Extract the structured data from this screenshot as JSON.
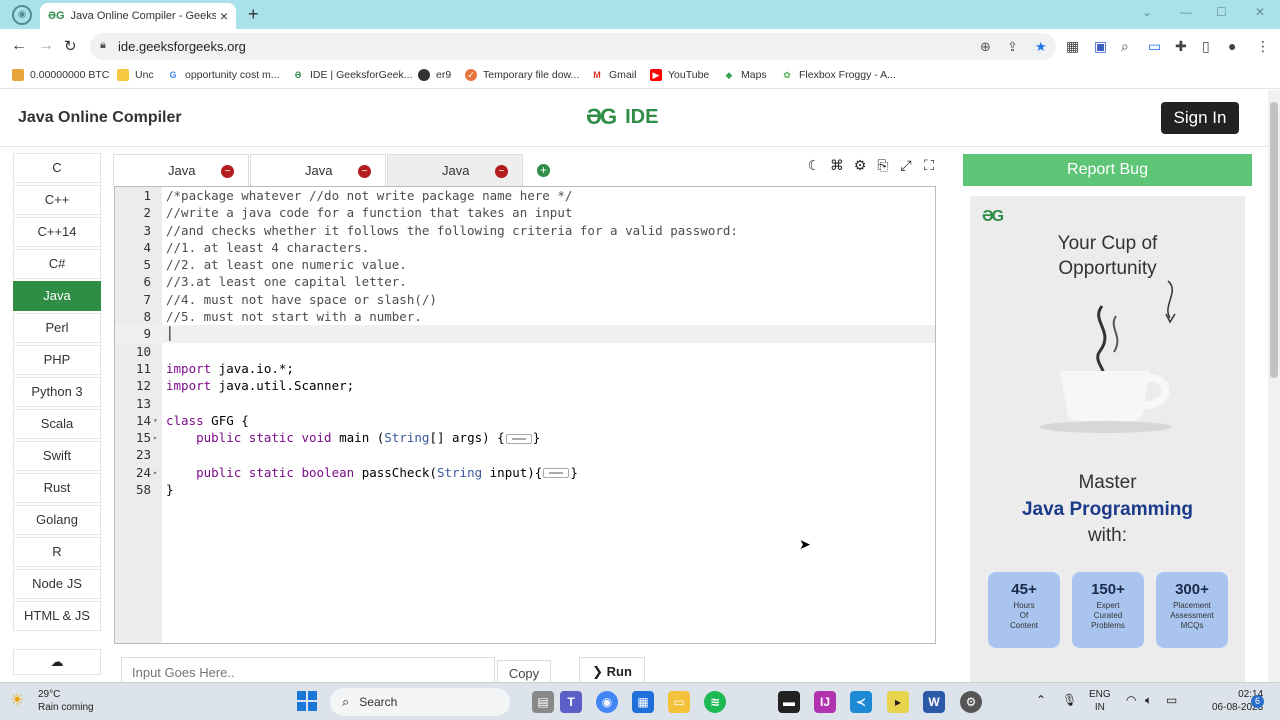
{
  "browser": {
    "tab_title": "Java Online Compiler - GeeksforGeeks",
    "url": "ide.geeksforgeeks.org",
    "bookmarks": [
      "0.00000000 BTC",
      "Unc",
      "opportunity cost m...",
      "IDE | GeeksforGeek...",
      "er9",
      "Temporary file dow...",
      "Gmail",
      "YouTube",
      "Maps",
      "Flexbox Froggy - A..."
    ]
  },
  "header": {
    "title": "Java Online Compiler",
    "brand_text": "IDE",
    "signin_label": "Sign In"
  },
  "languages": [
    "C",
    "C++",
    "C++14",
    "C#",
    "Java",
    "Perl",
    "PHP",
    "Python 3",
    "Scala",
    "Swift",
    "Rust",
    "Golang",
    "R",
    "Node JS",
    "HTML & JS"
  ],
  "active_language": "Java",
  "editor_tabs": [
    {
      "label": "Java",
      "active": false
    },
    {
      "label": "Java",
      "active": false
    },
    {
      "label": "Java",
      "active": true
    }
  ],
  "code_lines": [
    {
      "n": "1",
      "text": "/*package whatever //do not write package name here */"
    },
    {
      "n": "2",
      "text": "//write a java code for a function that takes an input"
    },
    {
      "n": "3",
      "text": "//and checks whether it follows the following criteria for a valid password:"
    },
    {
      "n": "4",
      "text": "//1. at least 4 characters."
    },
    {
      "n": "5",
      "text": "//2. at least one numeric value."
    },
    {
      "n": "6",
      "text": "//3.at least one capital letter."
    },
    {
      "n": "7",
      "text": "//4. must not have space or slash(/)"
    },
    {
      "n": "8",
      "text": "//5. must not start with a number."
    },
    {
      "n": "9",
      "text": ""
    },
    {
      "n": "10",
      "text": ""
    },
    {
      "n": "11",
      "text": "import java.io.*;"
    },
    {
      "n": "12",
      "text": "import java.util.Scanner;"
    },
    {
      "n": "13",
      "text": ""
    },
    {
      "n": "14",
      "text": "class GFG {"
    },
    {
      "n": "15",
      "text": "    public static void main (String[] args) {"
    },
    {
      "n": "23",
      "text": ""
    },
    {
      "n": "24",
      "text": "    public static boolean passCheck(String input){"
    },
    {
      "n": "58",
      "text": "}"
    }
  ],
  "input": {
    "placeholder": "Input Goes Here.."
  },
  "copy_label": "Copy",
  "run_label": "Run",
  "report_bug_label": "Report Bug",
  "ad": {
    "cup_title": "Your Cup of\nOpportunity",
    "master": "Master",
    "java": "Java Programming",
    "with": "with:",
    "stats": [
      {
        "num": "45+",
        "label": "Hours\nOf\nContent"
      },
      {
        "num": "150+",
        "label": "Expert\nCurated\nProblems"
      },
      {
        "num": "300+",
        "label": "Placement\nAssessment\nMCQs"
      }
    ]
  },
  "taskbar": {
    "temp": "29°C",
    "weather": "Rain coming",
    "search_label": "Search",
    "lang": "ENG",
    "region": "IN",
    "time": "02:14",
    "date": "06-08-2023",
    "notifications": "6"
  },
  "colors": {
    "brand_green": "#2f8d46",
    "report_green": "#5ec576",
    "signin_bg": "#222222"
  }
}
